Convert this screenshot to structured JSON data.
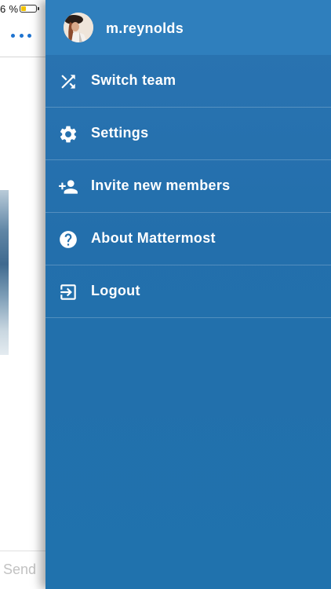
{
  "status_bar": {
    "battery_text": "6 %",
    "battery_level": 0.35
  },
  "channel": {
    "more_icon": "more-horizontal-icon",
    "send_label": "Send"
  },
  "drawer": {
    "user": {
      "username": "m.reynolds",
      "avatar": "user-avatar"
    },
    "menu": [
      {
        "icon": "switch-team-icon",
        "label": "Switch team"
      },
      {
        "icon": "gear-icon",
        "label": "Settings"
      },
      {
        "icon": "add-user-icon",
        "label": "Invite new members"
      },
      {
        "icon": "question-circle-icon",
        "label": "About Mattermost"
      },
      {
        "icon": "logout-icon",
        "label": "Logout"
      }
    ]
  },
  "colors": {
    "drawer_bg": "#2372ad",
    "drawer_header": "#2f7fbd",
    "accent_blue": "#1e73d0",
    "battery_fill": "#f2c200",
    "text_light": "#ffffff"
  }
}
